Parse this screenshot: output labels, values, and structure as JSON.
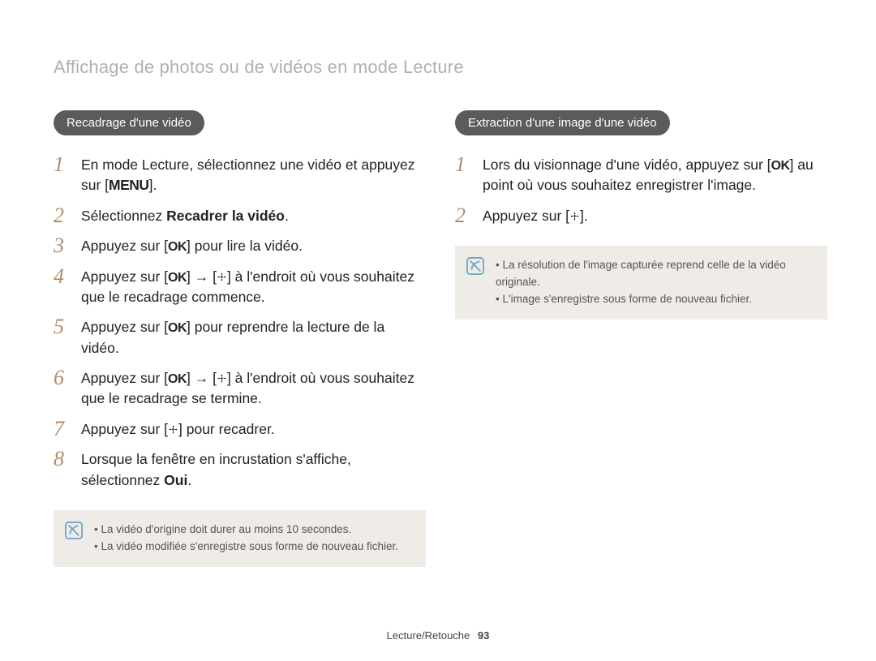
{
  "page_title": "Affichage de photos ou de vidéos en mode Lecture",
  "left": {
    "pill": "Recadrage d'une vidéo",
    "steps": [
      {
        "n": "1",
        "pre": "En mode Lecture, sélectionnez une vidéo et appuyez sur [",
        "icon": "menu",
        "post": "]."
      },
      {
        "n": "2",
        "pre": "Sélectionnez ",
        "bold": "Recadrer la vidéo",
        "post": "."
      },
      {
        "n": "3",
        "pre": "Appuyez sur [",
        "icon": "ok",
        "post": "] pour lire la vidéo."
      },
      {
        "n": "4",
        "pre": "Appuyez sur [",
        "icon": "ok",
        "mid": "] → [",
        "icon2": "down",
        "post": "] à l'endroit où vous souhaitez que le recadrage commence."
      },
      {
        "n": "5",
        "pre": "Appuyez sur [",
        "icon": "ok",
        "post": "] pour reprendre la lecture de la vidéo."
      },
      {
        "n": "6",
        "pre": "Appuyez sur [",
        "icon": "ok",
        "mid": "] → [",
        "icon2": "down",
        "post": "] à l'endroit où vous souhaitez que le recadrage se termine."
      },
      {
        "n": "7",
        "pre": "Appuyez sur [",
        "icon": "down",
        "post": "] pour recadrer."
      },
      {
        "n": "8",
        "pre": "Lorsque la fenêtre en incrustation s'affiche, sélectionnez ",
        "bold": "Oui",
        "post": "."
      }
    ],
    "note": [
      "La vidéo d'origine doit durer au moins 10 secondes.",
      "La vidéo modifiée s'enregistre sous forme de nouveau fichier."
    ]
  },
  "right": {
    "pill": "Extraction d'une image d'une vidéo",
    "steps": [
      {
        "n": "1",
        "pre": "Lors du visionnage d'une vidéo, appuyez sur [",
        "icon": "ok",
        "post": "] au point où vous souhaitez enregistrer l'image."
      },
      {
        "n": "2",
        "pre": "Appuyez sur [",
        "icon": "down",
        "post": "]."
      }
    ],
    "note": [
      "La résolution de l'image capturée reprend celle de la vidéo originale.",
      "L'image s'enregistre sous forme de nouveau fichier."
    ]
  },
  "footer": {
    "section": "Lecture/Retouche",
    "page": "93"
  }
}
